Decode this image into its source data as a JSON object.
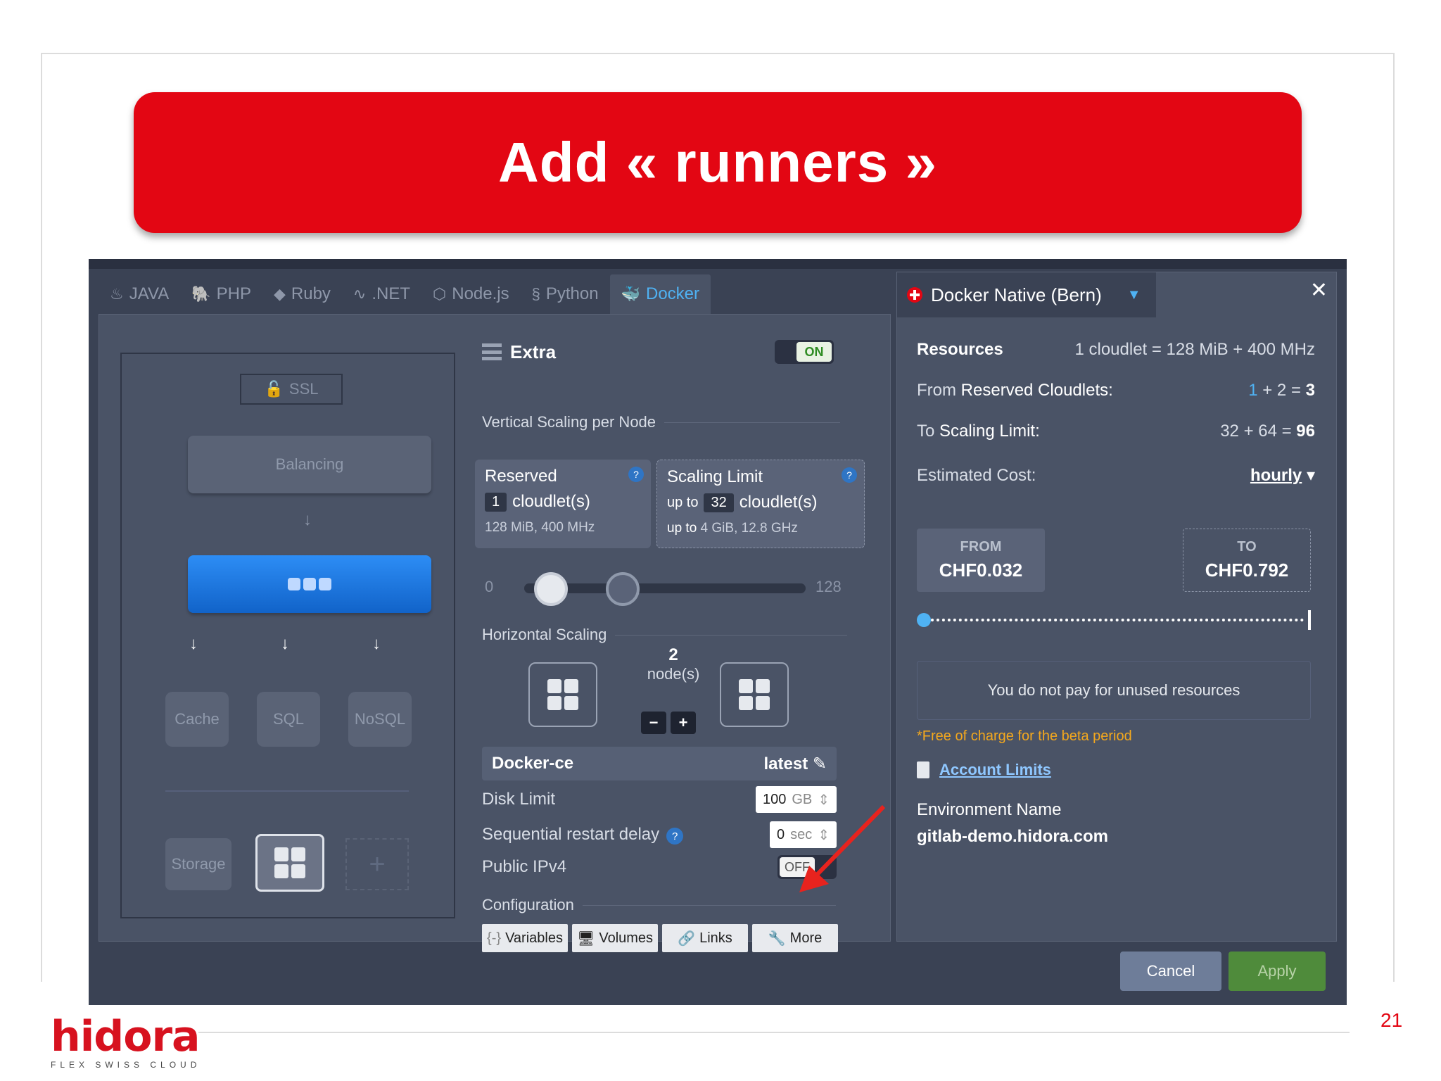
{
  "slide": {
    "title": "Add « runners »",
    "page_number": "21",
    "logo": {
      "word": "hidora",
      "tagline": "FLEX SWISS CLOUD"
    }
  },
  "tabs": [
    {
      "label": "JAVA",
      "icon": "java-icon"
    },
    {
      "label": "PHP",
      "icon": "php-icon"
    },
    {
      "label": "Ruby",
      "icon": "ruby-icon"
    },
    {
      "label": ".NET",
      "icon": "dotnet-icon"
    },
    {
      "label": "Node.js",
      "icon": "nodejs-icon"
    },
    {
      "label": "Python",
      "icon": "python-icon"
    },
    {
      "label": "Docker",
      "icon": "docker-icon",
      "active": true
    }
  ],
  "topology": {
    "ssl": "SSL",
    "balancing": "Balancing",
    "cache": "Cache",
    "sql": "SQL",
    "nosql": "NoSQL",
    "storage": "Storage",
    "add": "+"
  },
  "extra": {
    "title": "Extra",
    "toggle": "ON",
    "vertical_label": "Vertical Scaling per Node",
    "reserved": {
      "title": "Reserved",
      "value": "1",
      "unit": "cloudlet(s)",
      "sub": "128 MiB, 400 MHz"
    },
    "scaling_limit": {
      "title": "Scaling Limit",
      "prefix": "up to",
      "value": "32",
      "unit": "cloudlet(s)",
      "sub_prefix": "up to",
      "sub": "4 GiB, 12.8 GHz"
    },
    "slider_min": "0",
    "slider_max": "128",
    "horizontal_label": "Horizontal Scaling",
    "nodes_count": "2",
    "nodes_unit": "node(s)",
    "minus": "−",
    "plus": "+",
    "image_name": "Docker-ce",
    "image_tag": "latest",
    "disk_limit_label": "Disk Limit",
    "disk_limit_value": "100",
    "disk_limit_unit": "GB",
    "restart_delay_label": "Sequential restart delay",
    "restart_delay_value": "0",
    "restart_delay_unit": "sec",
    "ipv4_label": "Public IPv4",
    "ipv4_toggle": "OFF",
    "configuration_label": "Configuration",
    "buttons": {
      "variables": "Variables",
      "volumes": "Volumes",
      "links": "Links",
      "more": "More"
    }
  },
  "right": {
    "region": "Docker Native (Bern)",
    "resources_label": "Resources",
    "resources_value": "1 cloudlet = 128 MiB + 400 MHz",
    "reserved_label_a": "From",
    "reserved_label_b": "Reserved Cloudlets:",
    "reserved_calc_a": "1",
    "reserved_calc_b": "+ 2 = ",
    "reserved_total": "3",
    "limit_label_a": "To",
    "limit_label_b": "Scaling Limit:",
    "limit_calc": "32 + 64 = ",
    "limit_total": "96",
    "cost_label": "Estimated Cost:",
    "cost_period": "hourly",
    "from_label": "FROM",
    "from_value": "CHF0.032",
    "to_label": "TO",
    "to_value": "CHF0.792",
    "info": "You do not pay for unused resources",
    "beta_note": "*Free of charge for the beta period",
    "account_limits": "Account Limits",
    "env_name_label": "Environment Name",
    "env_name_value": "gitlab-demo.hidora.com"
  },
  "footer": {
    "cancel": "Cancel",
    "apply": "Apply"
  },
  "colors": {
    "brand_red": "#e30613",
    "panel": "#4a5366",
    "accent_blue": "#4fb2f3",
    "apply_green": "#4f8b3b"
  }
}
